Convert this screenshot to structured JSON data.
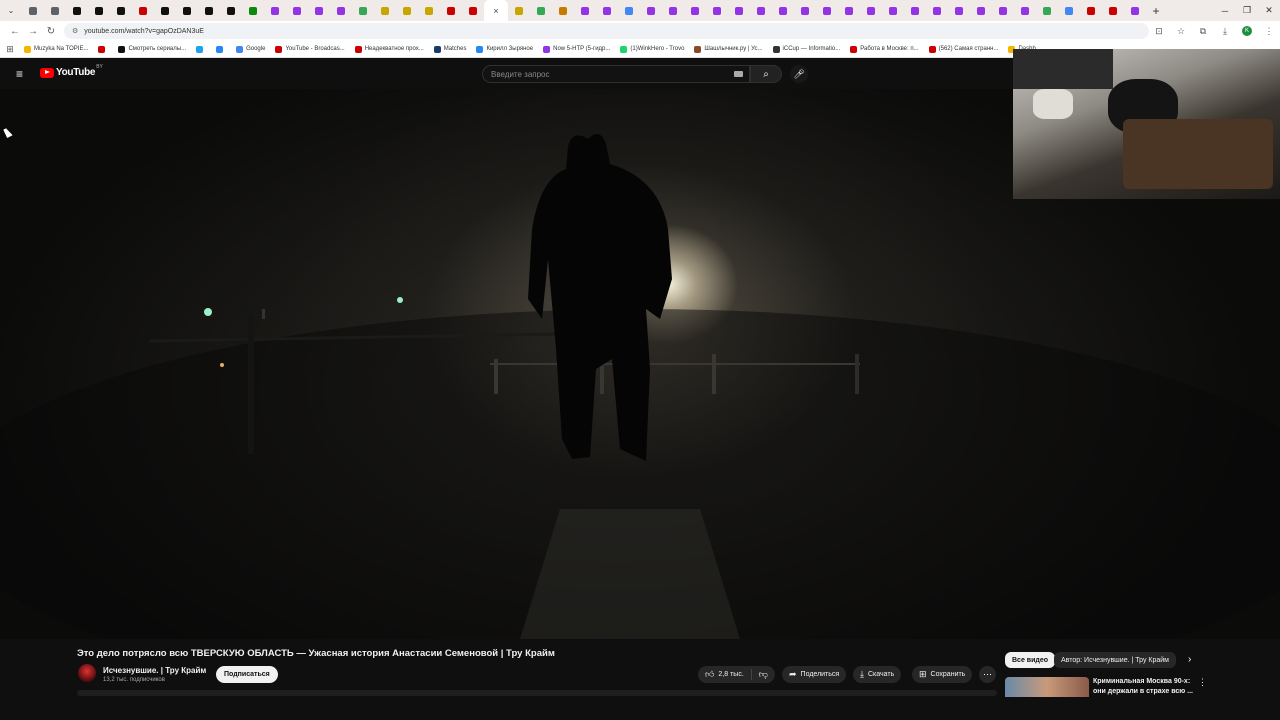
{
  "browser": {
    "tab_colors": [
      "#5f6368",
      "#5f6368",
      "#111111",
      "#111111",
      "#111111",
      "#cc0000",
      "#111111",
      "#111111",
      "#111111",
      "#111111",
      "#0a8a0a",
      "#9334e6",
      "#9334e6",
      "#9334e6",
      "#9334e6",
      "#34a853",
      "#c6a700",
      "#c6a700",
      "#c6a700",
      "#cc0000",
      "#cc0000"
    ],
    "tab_colors_after": [
      "#c6a700",
      "#34a853",
      "#c67b00",
      "#9334e6",
      "#9334e6",
      "#4285f4",
      "#9334e6",
      "#9334e6",
      "#9334e6",
      "#9334e6",
      "#9334e6",
      "#9334e6",
      "#9334e6",
      "#9334e6",
      "#9334e6",
      "#9334e6",
      "#9334e6",
      "#9334e6",
      "#9334e6",
      "#9334e6",
      "#9334e6",
      "#9334e6",
      "#9334e6",
      "#9334e6",
      "#34a853",
      "#4285f4",
      "#cc0000",
      "#cc0000",
      "#9334e6"
    ],
    "active_tab_close": "×",
    "new_tab": "+",
    "url": "youtube.com/watch?v=gapOzDAN3uE",
    "profile_initial": "K",
    "bookmarks": [
      {
        "label": "Muzyka Na TOPIE...",
        "color": "#f4b400"
      },
      {
        "label": "",
        "color": "#cc0000"
      },
      {
        "label": "Смотреть сериалы...",
        "color": "#111111"
      },
      {
        "label": "",
        "color": "#1da1f2"
      },
      {
        "label": "",
        "color": "#2787f5"
      },
      {
        "label": "Google",
        "color": "#4285f4"
      },
      {
        "label": "YouTube - Broadcas...",
        "color": "#cc0000"
      },
      {
        "label": "Неадекватное прох...",
        "color": "#cc0000"
      },
      {
        "label": "Matches",
        "color": "#1a3a6a"
      },
      {
        "label": "Кирилл Зыряное",
        "color": "#2787f5"
      },
      {
        "label": "Now 5-HTP (5-гидр...",
        "color": "#9334e6"
      },
      {
        "label": "(1)WinkHero - Trovo",
        "color": "#19d66b"
      },
      {
        "label": "Шашлычник.ру | Ус...",
        "color": "#8a4a2a"
      },
      {
        "label": "iCCup — Informatio...",
        "color": "#333333"
      },
      {
        "label": "Работа в Москве: п...",
        "color": "#cc0000"
      },
      {
        "label": "(562) Самая странн...",
        "color": "#cc0000"
      },
      {
        "label": "Dashb...",
        "color": "#f4b400"
      }
    ]
  },
  "youtube": {
    "logo_text": "YouTube",
    "country_code": "BY",
    "search_placeholder": "Введите запрос",
    "video_title": "Это дело потрясло всю ТВЕРСКУЮ ОБЛАСТЬ — Ужасная история Анастасии Семеновой | Тру Крайм",
    "channel_name": "Исчезнувшие. | Тру Крайм",
    "subscribers": "13,2 тыс. подписчиков",
    "subscribe_label": "Подписаться",
    "likes": "2,8 тыс.",
    "share_label": "Поделиться",
    "download_label": "Скачать",
    "save_label": "Сохранить",
    "chips": [
      "Все видео",
      "Автор: Исчезнувшие. | Тру Крайм"
    ],
    "rec_title": "Криминальная Москва 90-х: они держали в страхе всю ..."
  }
}
